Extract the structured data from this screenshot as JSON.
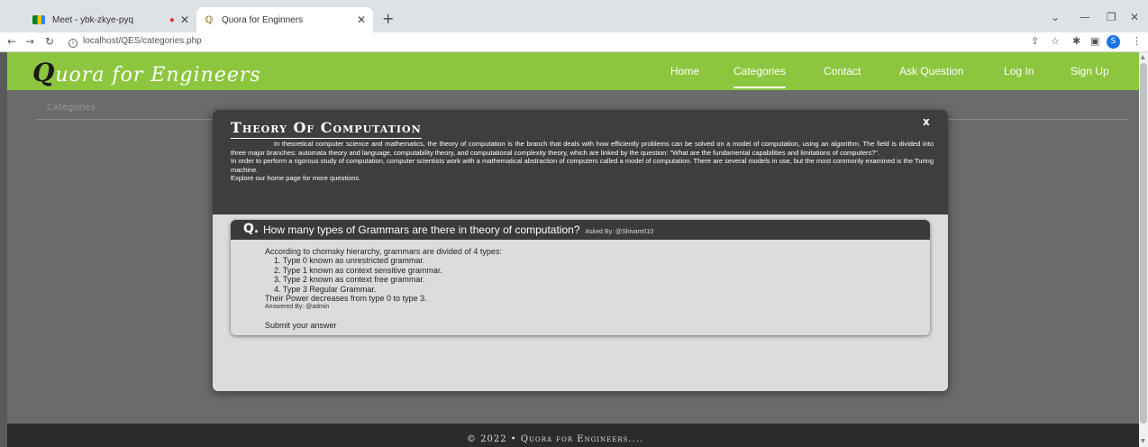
{
  "browser": {
    "tabs": [
      {
        "title": "Meet - ybk-zkye-pyq",
        "active": false
      },
      {
        "title": "Quora for Enginners",
        "active": true
      }
    ],
    "new_tab": "+",
    "url": "localhost/QES/categories.php",
    "profile_initial": "S"
  },
  "site": {
    "brand_initial": "Q",
    "brand_rest": "uora for Engineers",
    "nav": [
      "Home",
      "Categories",
      "Contact",
      "Ask Question",
      "Log In",
      "Sign Up"
    ],
    "active_nav": "Categories",
    "accent_color": "#8cc63f"
  },
  "page": {
    "section_label": "Categories"
  },
  "modal": {
    "title": "Theory Of Computation",
    "close": "x",
    "paragraphs": [
      "In theoretical computer science and mathematics, the theory of computation is the branch that deals with how efficiently problems can be solved on a model of computation, using an algorithm. The field is divided into three major branches: automata theory and language, computability theory, and computational complexity theory, which are linked by the question: \"What are the fundamental capabilities and limitations of computers?\".",
      "In order to perform a rigorous study of computation, computer scientists work with a mathematical abstraction of computers called a model of computation. There are several models in use, but the most commonly examined is the Turing machine.",
      "Explore our home page for more questions."
    ],
    "question": {
      "marker": "Q.",
      "text": "How many types of Grammars are there in theory of computation?",
      "asked_by": "Asked By: @Shivam010",
      "answer_intro": "According to chomsky hierarchy, grammars are divided of 4 types:",
      "answer_items": [
        "1. Type 0 known as unrestricted grammar.",
        "2. Type 1 known as context sensitive grammar.",
        "3. Type 2 known as context free grammar.",
        "4. Type 3 Regular Grammar."
      ],
      "answer_outro": "Their Power decreases from type 0 to type 3.",
      "answered_by": "Answered By: @admin",
      "submit_label": "Submit your answer"
    }
  },
  "footer": {
    "text": "© 2022 • Quora for Engineers...."
  }
}
